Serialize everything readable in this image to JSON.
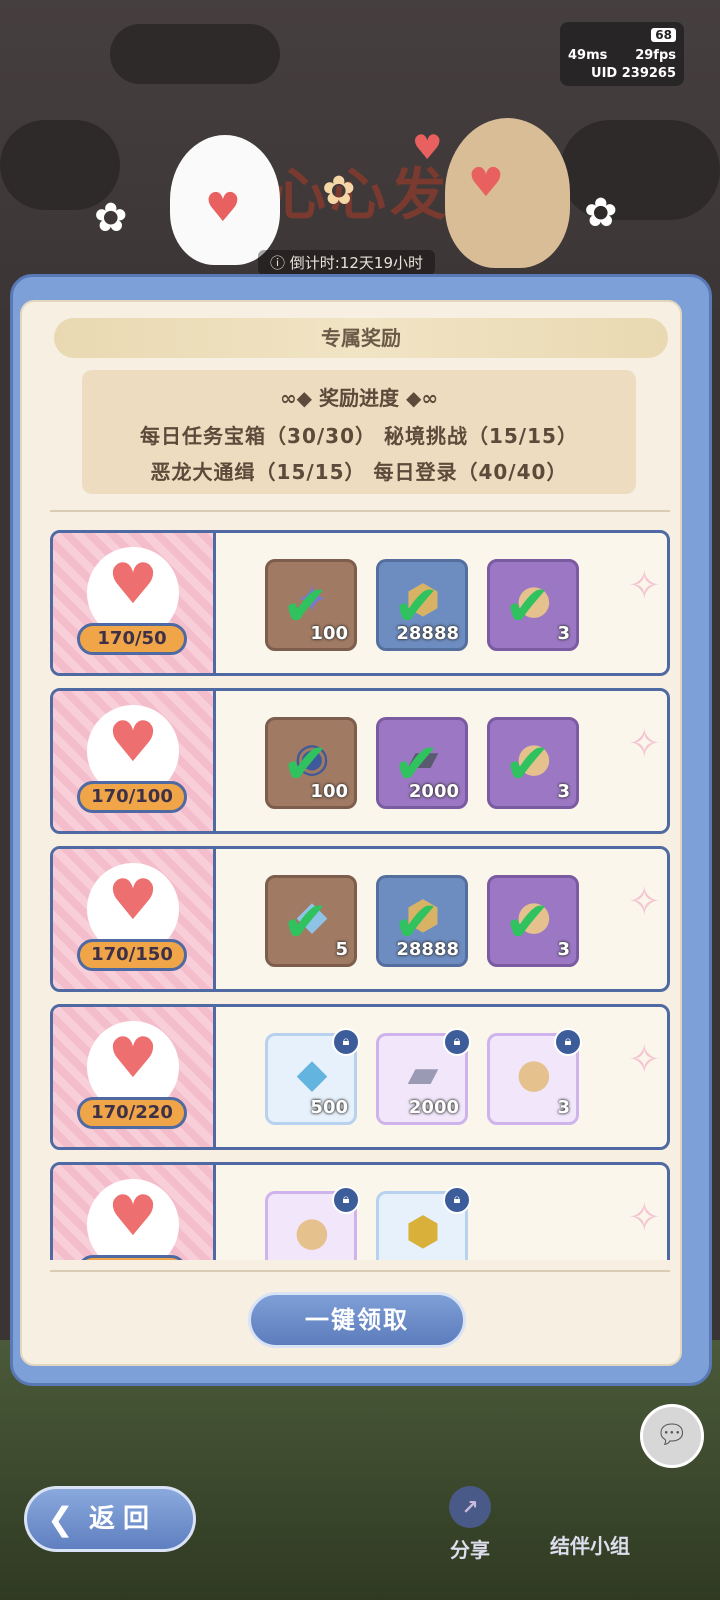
{
  "status": {
    "battery": "68",
    "ping": "49ms",
    "fps": "29fps",
    "uid": "UID 239265"
  },
  "banner": {
    "title": "心心发",
    "countdown": "倒计时:12天19小时"
  },
  "panel": {
    "title": "专属奖励",
    "progress_title": "奖励进度",
    "progress_line1": "每日任务宝箱（30/30） 秘境挑战（15/15）",
    "progress_line2": "恶龙大通缉（15/15） 每日登录（40/40）"
  },
  "rows": [
    {
      "label": "170/50",
      "items": [
        {
          "qty": "100",
          "icon": "star-crystal-icon",
          "claimed": true,
          "color": "brown"
        },
        {
          "qty": "28888",
          "icon": "gold-coin-icon",
          "claimed": true,
          "color": "blue"
        },
        {
          "qty": "3",
          "icon": "puppy-token-icon",
          "claimed": true,
          "color": "purple"
        }
      ]
    },
    {
      "label": "170/100",
      "items": [
        {
          "qty": "100",
          "icon": "cat-orb-icon",
          "claimed": true,
          "color": "brown"
        },
        {
          "qty": "2000",
          "icon": "silver-ingot-icon",
          "claimed": true,
          "color": "purple"
        },
        {
          "qty": "3",
          "icon": "puppy-token-icon",
          "claimed": true,
          "color": "purple"
        }
      ]
    },
    {
      "label": "170/150",
      "items": [
        {
          "qty": "5",
          "icon": "blue-crystal-icon",
          "claimed": true,
          "color": "brown"
        },
        {
          "qty": "28888",
          "icon": "gold-coin-icon",
          "claimed": true,
          "color": "blue"
        },
        {
          "qty": "3",
          "icon": "puppy-token-icon",
          "claimed": true,
          "color": "purple"
        }
      ]
    },
    {
      "label": "170/220",
      "items": [
        {
          "qty": "500",
          "icon": "blue-crystal-icon",
          "claimed": false,
          "color": "light-blue"
        },
        {
          "qty": "2000",
          "icon": "silver-ingot-icon",
          "claimed": false,
          "color": "light-purple"
        },
        {
          "qty": "3",
          "icon": "puppy-token-icon",
          "claimed": false,
          "color": "light-purple"
        }
      ]
    },
    {
      "label": "",
      "items": [
        {
          "qty": "",
          "icon": "puppy-token-icon",
          "claimed": false,
          "color": "light-purple"
        },
        {
          "qty": "",
          "icon": "gold-coin-icon",
          "claimed": false,
          "color": "light-blue"
        }
      ]
    }
  ],
  "claim_all_label": "一键领取",
  "back_label": "返回",
  "share_label": "分享",
  "group_label": "结伴小组"
}
